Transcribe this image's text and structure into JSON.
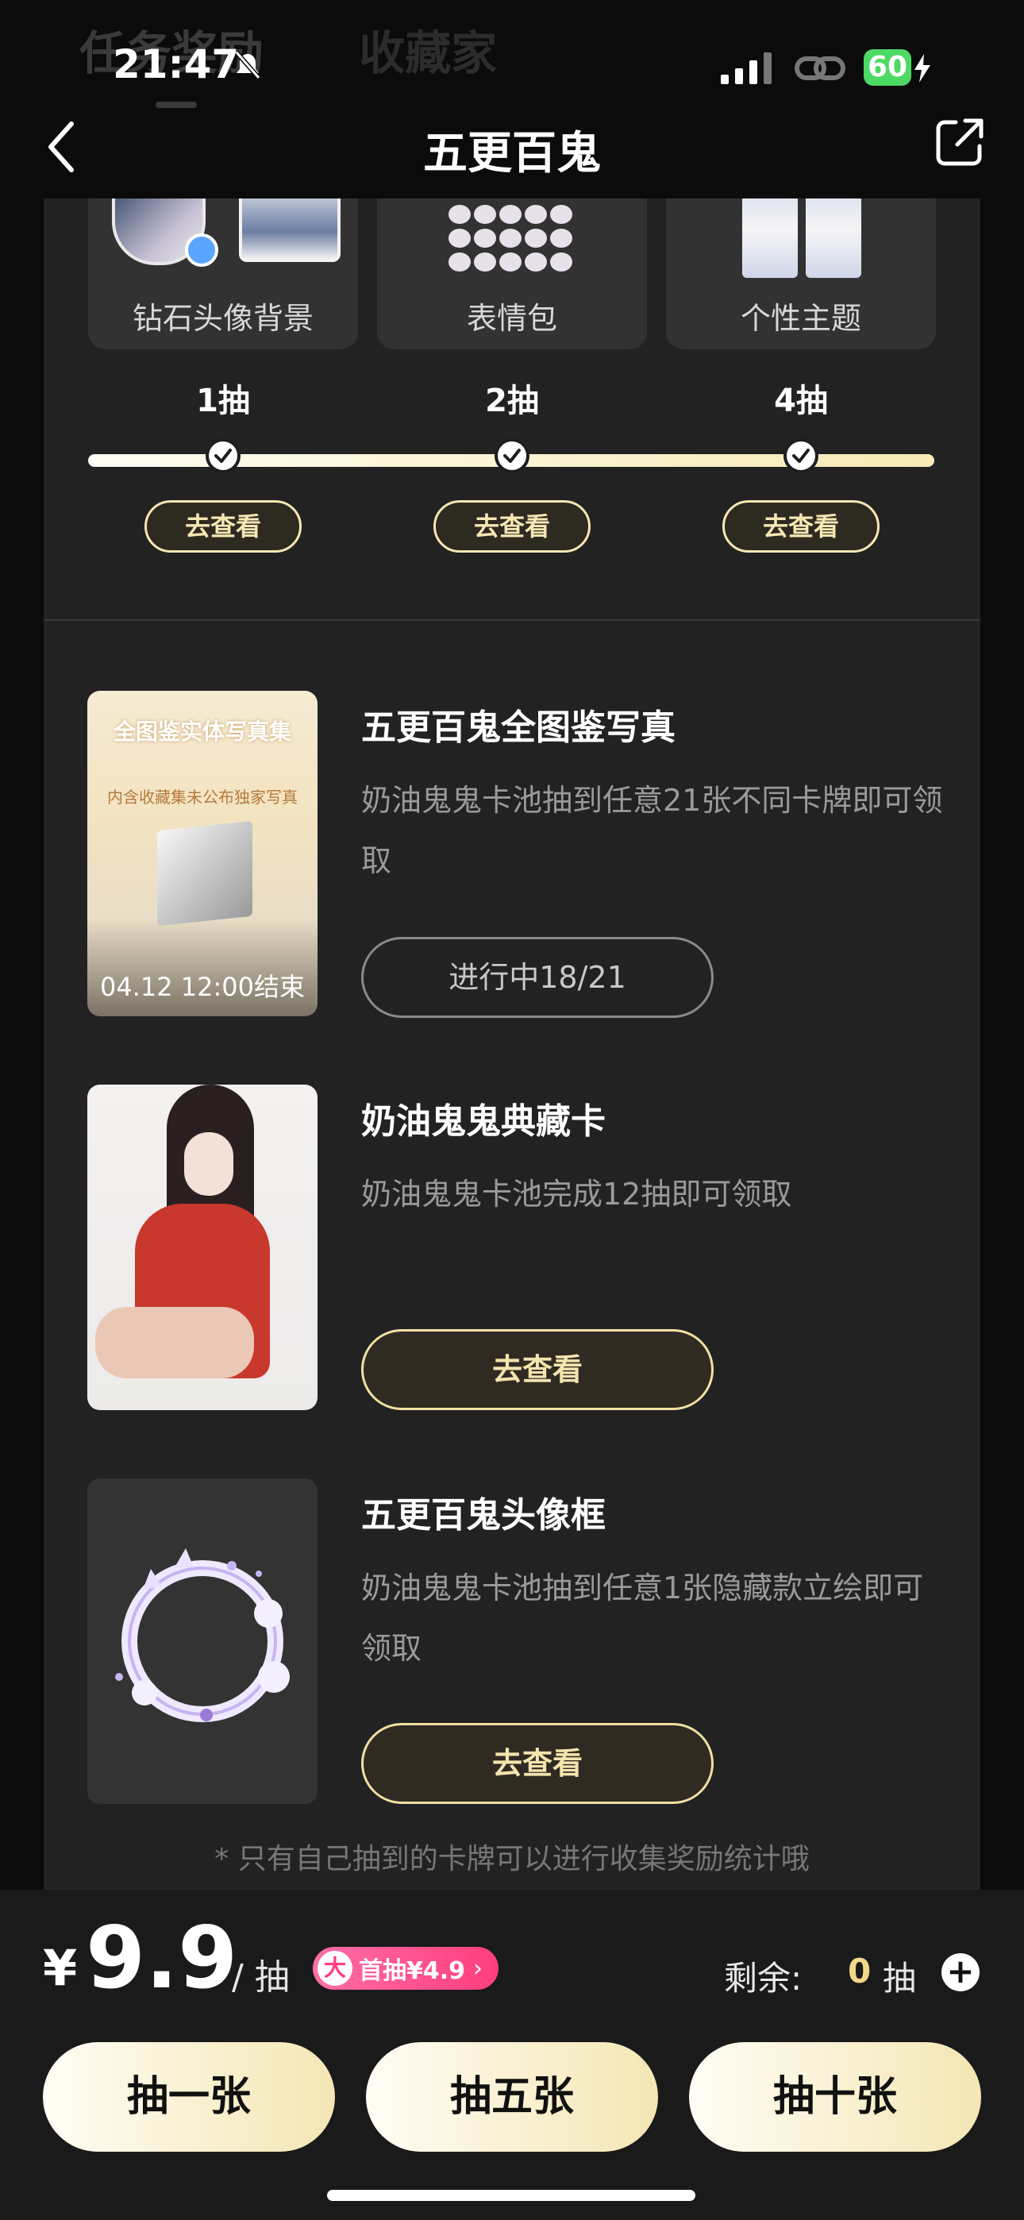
{
  "status_bar": {
    "time": "21:47",
    "battery": "60"
  },
  "bg_tabs": [
    "任务奖励",
    "收藏家"
  ],
  "nav": {
    "title": "五更百鬼"
  },
  "rewards": [
    {
      "label": "钻石头像背景"
    },
    {
      "label": "表情包"
    },
    {
      "label": "个性主题"
    }
  ],
  "steps": [
    {
      "label": "1抽",
      "button": "去查看"
    },
    {
      "label": "2抽",
      "button": "去查看"
    },
    {
      "label": "4抽",
      "button": "去查看"
    }
  ],
  "tasks": [
    {
      "title": "五更百鬼全图鉴写真",
      "desc": "奶油鬼鬼卡池抽到任意21张不同卡牌即可领取",
      "button": "进行中18/21",
      "thumb_heading": "全图鉴实体写真集",
      "thumb_sub": "内含收藏集未公布独家写真",
      "thumb_end": "04.12 12:00结束"
    },
    {
      "title": "奶油鬼鬼典藏卡",
      "desc": "奶油鬼鬼卡池完成12抽即可领取",
      "button": "去查看"
    },
    {
      "title": "五更百鬼头像框",
      "desc": "奶油鬼鬼卡池抽到任意1张隐藏款立绘即可领取",
      "button": "去查看"
    }
  ],
  "footnote": "* 只有自己抽到的卡牌可以进行收集奖励统计哦",
  "bottom": {
    "currency": "¥",
    "price": "9.9",
    "unit": "/ 抽",
    "first_badge": "大",
    "first_text": "首抽¥4.9",
    "remaining_label": "剩余:",
    "remaining_value": "0",
    "remaining_unit": "抽",
    "buttons": [
      "抽一张",
      "抽五张",
      "抽十张"
    ]
  },
  "colors": {
    "accent_gold": "#f3e4ae",
    "pink": "#ff3d7f",
    "panel": "#222222"
  }
}
